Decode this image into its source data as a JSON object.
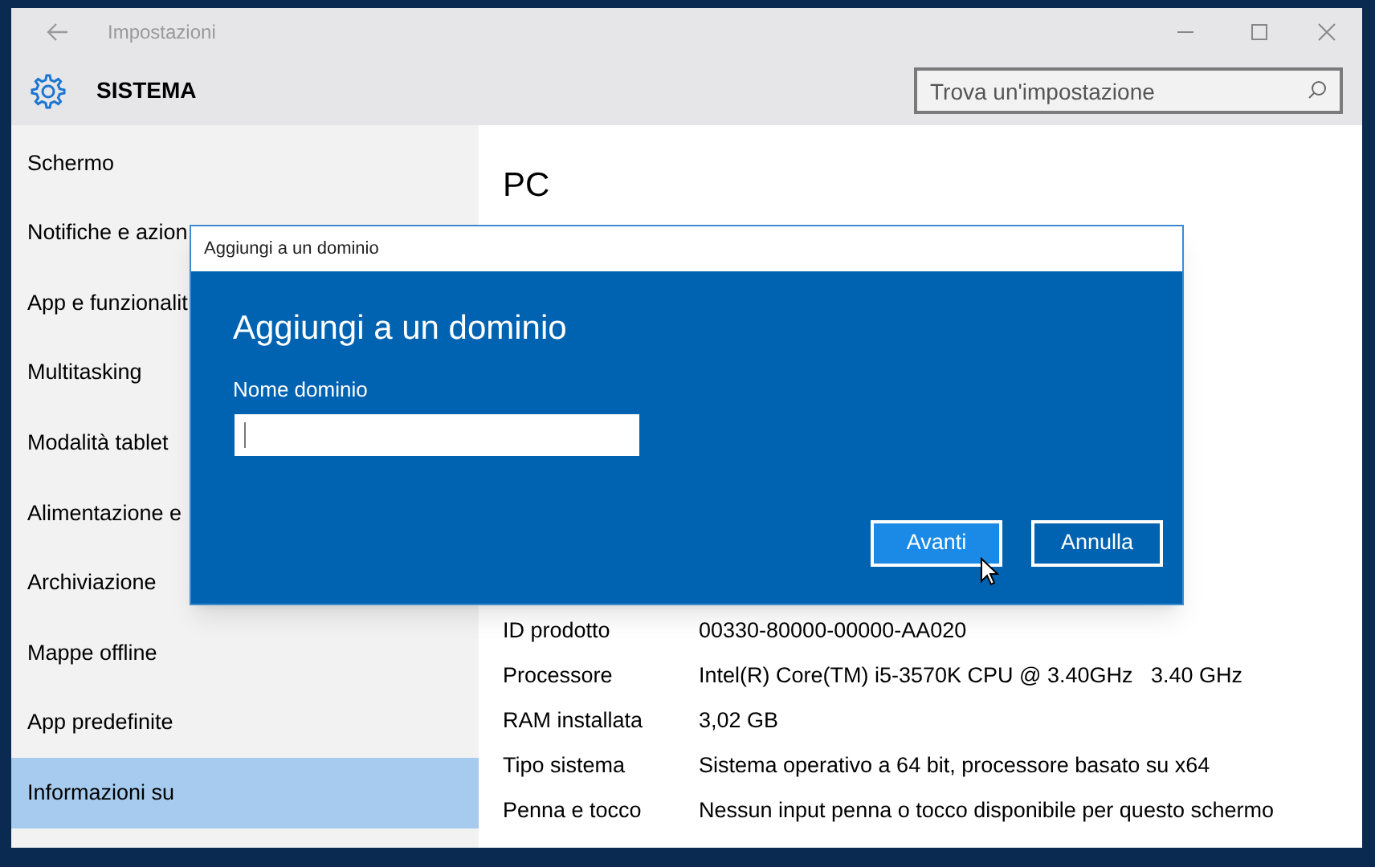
{
  "window": {
    "title": "Impostazioni"
  },
  "header": {
    "title": "SISTEMA",
    "search": {
      "placeholder": "Trova un'impostazione"
    }
  },
  "sidebar": {
    "items": [
      {
        "label": "Schermo",
        "selected": false
      },
      {
        "label": "Notifiche e azion",
        "selected": false
      },
      {
        "label": "App e funzionalit",
        "selected": false
      },
      {
        "label": "Multitasking",
        "selected": false
      },
      {
        "label": "Modalità tablet",
        "selected": false
      },
      {
        "label": "Alimentazione e",
        "selected": false
      },
      {
        "label": "Archiviazione",
        "selected": false
      },
      {
        "label": "Mappe offline",
        "selected": false
      },
      {
        "label": "App predefinite",
        "selected": false
      },
      {
        "label": "Informazioni su",
        "selected": true
      }
    ]
  },
  "content": {
    "title": "PC",
    "rows": [
      {
        "label": "ID prodotto",
        "value": "00330-80000-00000-AA020"
      },
      {
        "label": "Processore",
        "value": "Intel(R) Core(TM) i5-3570K CPU @ 3.40GHz   3.40 GHz"
      },
      {
        "label": "RAM installata",
        "value": "3,02 GB"
      },
      {
        "label": "Tipo sistema",
        "value": "Sistema operativo a 64 bit, processore basato su x64"
      },
      {
        "label": "Penna e tocco",
        "value": "Nessun input penna o tocco disponibile per questo schermo"
      }
    ]
  },
  "dialog": {
    "title": "Aggiungi a un dominio",
    "heading": "Aggiungi a un dominio",
    "field_label": "Nome dominio",
    "buttons": [
      {
        "label": "Avanti",
        "selected": true
      },
      {
        "label": "Annulla",
        "selected": false
      }
    ]
  }
}
